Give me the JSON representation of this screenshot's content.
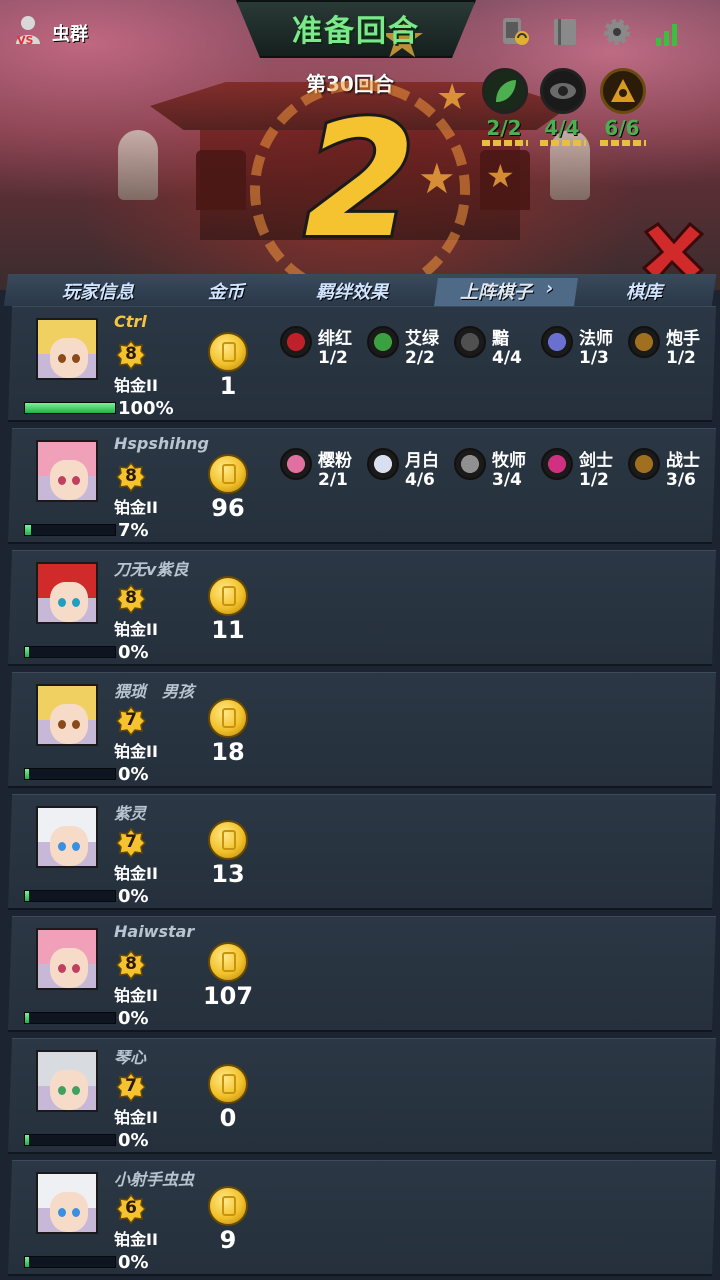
{
  "header": {
    "mode_label": "虫群",
    "phase_title": "准备回合",
    "round_label": "第30回合",
    "countdown": "2"
  },
  "buffs": [
    {
      "icon": "leaf-icon",
      "count": "2/2",
      "color": "#4caf50"
    },
    {
      "icon": "eye-icon",
      "count": "4/4",
      "color": "#9a9a9a"
    },
    {
      "icon": "hooded-figure-icon",
      "count": "6/6",
      "color": "#d89a20"
    }
  ],
  "columns": {
    "player_info": "玩家信息",
    "gold": "金币",
    "bond_effects": "羁绊效果",
    "deployed": "上阵棋子",
    "bench": "棋库"
  },
  "colors": {
    "accent_green": "#7be88a",
    "gold": "#f5c230",
    "hp_green": "#21b04a",
    "me_name": "#f5c542"
  },
  "players": [
    {
      "name": "Ctrl",
      "is_me": true,
      "level": "8",
      "rank": "铂金II",
      "hp_text": "100%",
      "hp_fraction": 1.0,
      "gold": "1",
      "hair": "#f0d060",
      "eyes": "#8a4a1a",
      "bonds": [
        {
          "name": "绯红",
          "count": "1/2",
          "icon": "rose-icon",
          "color": "#c0202a"
        },
        {
          "name": "艾绿",
          "count": "2/2",
          "icon": "leaf-icon",
          "color": "#3aa040"
        },
        {
          "name": "黯",
          "count": "4/4",
          "icon": "eye-icon",
          "color": "#505050"
        },
        {
          "name": "法师",
          "count": "1/3",
          "icon": "mage-icon",
          "color": "#6a70d0"
        },
        {
          "name": "炮手",
          "count": "1/2",
          "icon": "cannon-icon",
          "color": "#a07020"
        }
      ]
    },
    {
      "name": "Hspshihng",
      "is_me": false,
      "level": "8",
      "rank": "铂金II",
      "hp_text": "7%",
      "hp_fraction": 0.07,
      "gold": "96",
      "hair": "#f0a0b8",
      "eyes": "#c04060",
      "bonds": [
        {
          "name": "樱粉",
          "count": "2/1",
          "icon": "sakura-icon",
          "color": "#e070a0"
        },
        {
          "name": "月白",
          "count": "4/6",
          "icon": "moon-icon",
          "color": "#d8e0f0"
        },
        {
          "name": "牧师",
          "count": "3/4",
          "icon": "cross-icon",
          "color": "#909090"
        },
        {
          "name": "剑士",
          "count": "1/2",
          "icon": "sword-icon",
          "color": "#d03080"
        },
        {
          "name": "战士",
          "count": "3/6",
          "icon": "axe-icon",
          "color": "#a07020"
        }
      ]
    },
    {
      "name": "刀无v紫良",
      "is_me": false,
      "level": "8",
      "rank": "铂金II",
      "hp_text": "0%",
      "hp_fraction": 0.0,
      "gold": "11",
      "hair": "#d02a2a",
      "eyes": "#20a0c0",
      "bonds": []
    },
    {
      "name": "猥琐　男孩",
      "is_me": false,
      "level": "7",
      "rank": "铂金II",
      "hp_text": "0%",
      "hp_fraction": 0.0,
      "gold": "18",
      "hair": "#f0d060",
      "eyes": "#8a4a1a",
      "bonds": []
    },
    {
      "name": "紫灵",
      "is_me": false,
      "level": "7",
      "rank": "铂金II",
      "hp_text": "0%",
      "hp_fraction": 0.0,
      "gold": "13",
      "hair": "#eef0f4",
      "eyes": "#3a90e0",
      "bonds": []
    },
    {
      "name": "Haiwstar",
      "is_me": false,
      "level": "8",
      "rank": "铂金II",
      "hp_text": "0%",
      "hp_fraction": 0.0,
      "gold": "107",
      "hair": "#f0a0b8",
      "eyes": "#c04060",
      "bonds": []
    },
    {
      "name": "琴心",
      "is_me": false,
      "level": "7",
      "rank": "铂金II",
      "hp_text": "0%",
      "hp_fraction": 0.0,
      "gold": "0",
      "hair": "#d8dce0",
      "eyes": "#40a060",
      "bonds": []
    },
    {
      "name": "小射手虫虫",
      "is_me": false,
      "level": "6",
      "rank": "铂金II",
      "hp_text": "0%",
      "hp_fraction": 0.0,
      "gold": "9",
      "hair": "#eef0f4",
      "eyes": "#3a90e0",
      "bonds": []
    }
  ]
}
